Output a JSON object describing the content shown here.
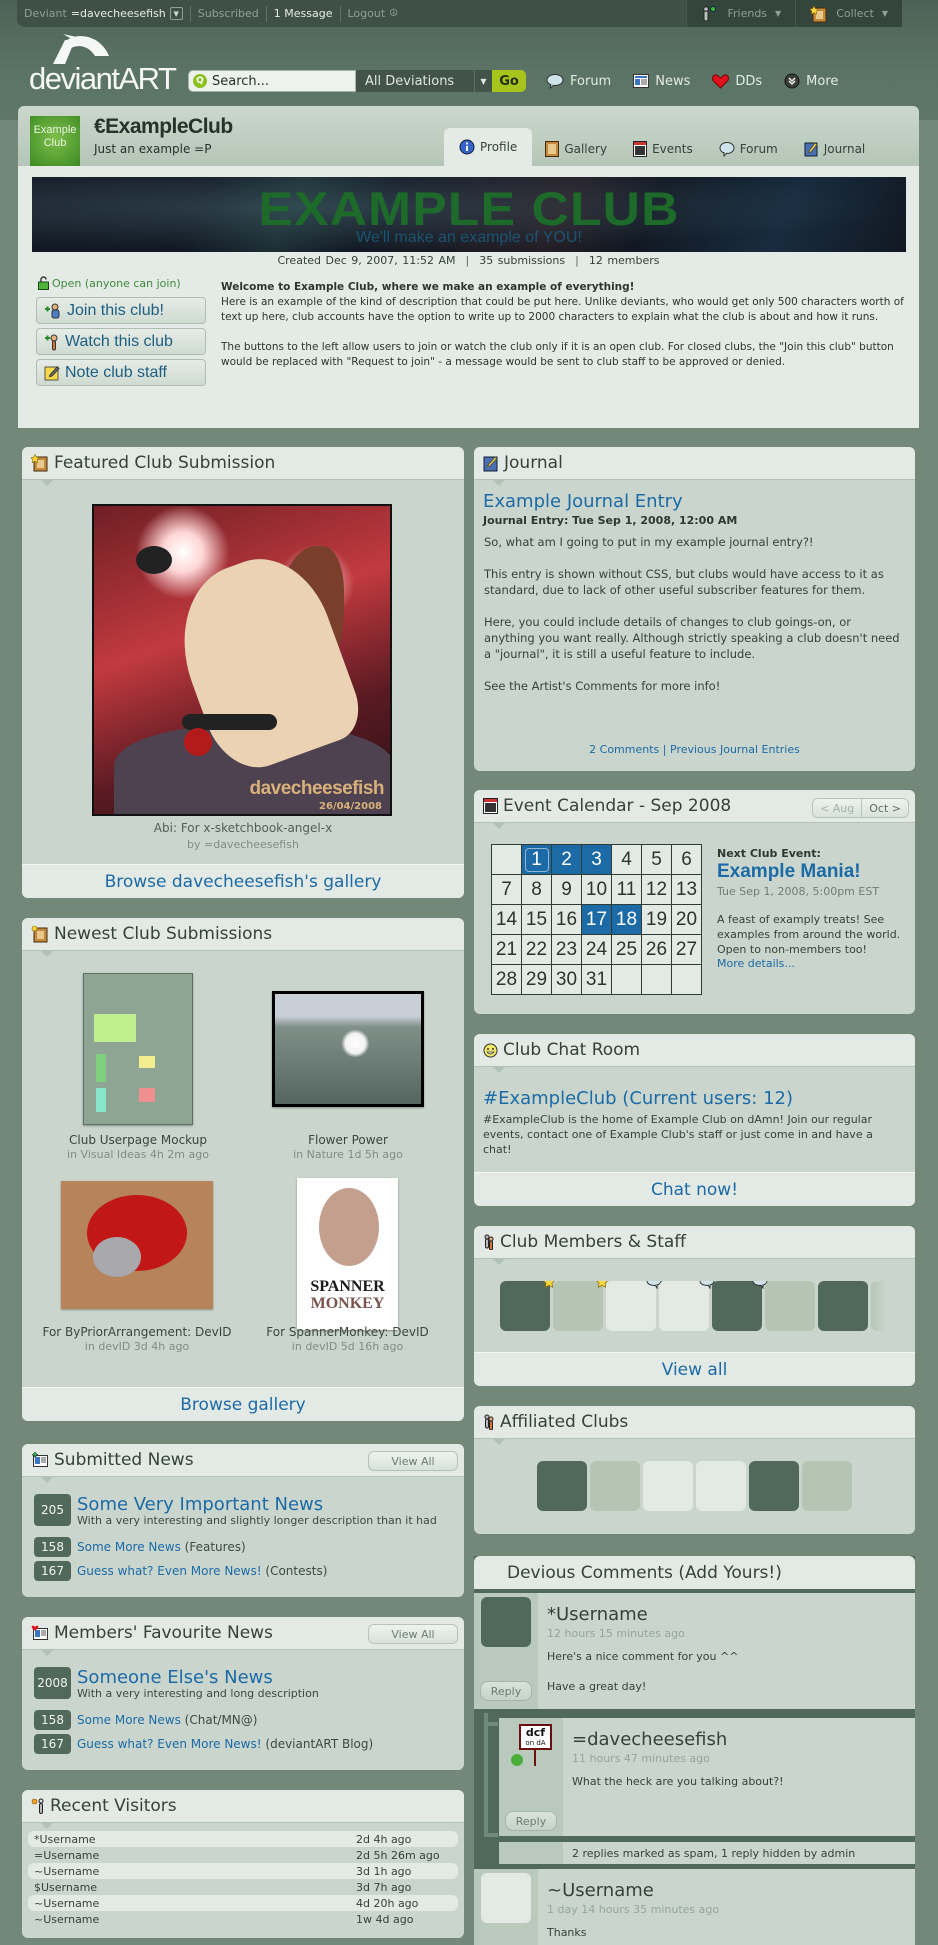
{
  "userbar": {
    "deviant_label": "Deviant",
    "username": "=davecheesefish",
    "subscribed": "Subscribed",
    "messages": "1 Message",
    "logout": "Logout",
    "friends": "Friends",
    "collect": "Collect"
  },
  "logo": {
    "text": "deviantART"
  },
  "search": {
    "placeholder": "Search...",
    "scope": "All Deviations",
    "go": "Go"
  },
  "topnav": [
    {
      "label": "Forum",
      "icon": "speech-bubble-icon"
    },
    {
      "label": "News",
      "icon": "newspaper-icon"
    },
    {
      "label": "DDs",
      "icon": "heart-icon"
    },
    {
      "label": "More",
      "icon": "chevron-down-circle-icon"
    }
  ],
  "club": {
    "icon_text": "Example Club",
    "name": "€ExampleClub",
    "tagline": "Just an example =P",
    "tabs": [
      {
        "label": "Profile",
        "icon": "info-icon",
        "active": true
      },
      {
        "label": "Gallery",
        "icon": "gallery-frame-icon"
      },
      {
        "label": "Events",
        "icon": "calendar-icon"
      },
      {
        "label": "Forum",
        "icon": "speech-bubble-icon"
      },
      {
        "label": "Journal",
        "icon": "journal-book-icon"
      }
    ],
    "banner_title": "EXAMPLE CLUB",
    "banner_subtitle": "We'll make an example of YOU!",
    "created": "Created Dec 9, 2007, 11:52 AM",
    "submissions": "35 submissions",
    "members": "12 members",
    "open_status": "Open (anyone can join)",
    "buttons": {
      "join": "Join this club!",
      "watch": "Watch this club",
      "note": "Note club staff"
    },
    "description_heading": "Welcome to Example Club, where we make an example of everything!",
    "description_p1": "Here is an example of the kind of description that could be put here.  Unlike deviants, who would get only 500 characters worth of text up here, club accounts have the option to write up to 2000 characters to explain what the club is about and how it runs.",
    "description_p2": "The buttons to the left allow users to join or watch the club only if it is an open club.  For closed clubs, the \"Join this club\" button would be replaced with \"Request to join\" - a message would be sent to club staff to be approved or denied."
  },
  "featured": {
    "title": "Featured Club Submission",
    "signature": "davecheesefish",
    "signature_date": "26/04/2008",
    "caption": "Abi: For x-sketchbook-angel-x",
    "by": "by =davecheesefish",
    "footer": "Browse davecheesefish's gallery"
  },
  "newest": {
    "title": "Newest Club Submissions",
    "items": [
      {
        "title": "Club Userpage Mockup",
        "meta": "in Visual Ideas 4h 2m ago"
      },
      {
        "title": "Flower Power",
        "meta": "in Nature 1d 5h ago"
      },
      {
        "title": "For ByPriorArrangement: DevID",
        "meta": "in devID 3d 4h ago"
      },
      {
        "title": "For SpannerMonkey: DevID",
        "meta": "in devID 5d 16h ago"
      }
    ],
    "spanner_text1": "SPANNER",
    "spanner_text2": "MONKEY",
    "footer": "Browse gallery"
  },
  "submitted_news": {
    "title": "Submitted News",
    "view_all": "View All",
    "top": {
      "count": "205",
      "title": "Some Very Important News",
      "desc": "With a very interesting and slightly longer description than it had"
    },
    "items": [
      {
        "count": "158",
        "title": "Some More News",
        "cat": "(Features)"
      },
      {
        "count": "167",
        "title": "Guess what? Even More News!",
        "cat": "(Contests)"
      }
    ]
  },
  "fav_news": {
    "title": "Members' Favourite News",
    "view_all": "View All",
    "top": {
      "count": "2008",
      "title": "Someone Else's News",
      "desc": "With a very interesting and long description"
    },
    "items": [
      {
        "count": "158",
        "title": "Some More News",
        "cat": "(Chat/MN@)"
      },
      {
        "count": "167",
        "title": "Guess what? Even More News!",
        "cat": "(deviantART Blog)"
      }
    ]
  },
  "visitors": {
    "title": "Recent Visitors",
    "rows": [
      {
        "name": "*Username",
        "time": "2d 4h ago"
      },
      {
        "name": "=Username",
        "time": "2d 5h 26m ago"
      },
      {
        "name": "~Username",
        "time": "3d 1h ago"
      },
      {
        "name": "$Username",
        "time": "3d 7h ago"
      },
      {
        "name": "~Username",
        "time": "4d 20h ago"
      },
      {
        "name": "~Username",
        "time": "1w 4d ago"
      }
    ]
  },
  "journal": {
    "title": "Journal",
    "entry_title": "Example Journal Entry",
    "entry_date": "Journal Entry: Tue Sep 1, 2008, 12:00 AM",
    "p1": "So, what am I going to put in my example journal entry?!",
    "p2": "This entry is shown without CSS, but clubs would have access to it as standard, due to lack of other useful subscriber features for them.",
    "p3": "Here, you could include details of changes to club goings-on, or anything you want really.  Although strictly speaking a club doesn't need a \"journal\", it is still a useful feature to include.",
    "p4": "See the Artist's Comments for more info!",
    "comments_link": "2 Comments",
    "separator": "|",
    "previous_link": "Previous Journal Entries"
  },
  "calendar": {
    "title": "Event Calendar - Sep 2008",
    "prev": "< Aug",
    "next": "Oct >",
    "weeks": [
      [
        "",
        "1",
        "2",
        "3",
        "4",
        "5",
        "6"
      ],
      [
        "7",
        "8",
        "9",
        "10",
        "11",
        "12",
        "13"
      ],
      [
        "14",
        "15",
        "16",
        "17",
        "18",
        "19",
        "20"
      ],
      [
        "21",
        "22",
        "23",
        "24",
        "25",
        "26",
        "27"
      ],
      [
        "28",
        "29",
        "30",
        "31",
        "",
        "",
        ""
      ]
    ],
    "event_days": [
      "1",
      "2",
      "3",
      "17",
      "18"
    ],
    "today": "1",
    "next_label": "Next Club Event:",
    "next_name": "Example Mania!",
    "next_date": "Tue Sep 1, 2008, 5:00pm EST",
    "next_desc": "A feast of examply treats! See examples from around the world. Open to non-members too!",
    "more_details": "More details..."
  },
  "chat": {
    "title": "Club Chat Room",
    "room": "#ExampleClub (Current users: 12)",
    "desc": "#ExampleClub is the home of Example Club on dAmn!  Join our regular events, contact one of Example Club's staff or just come in and have a chat!",
    "footer": "Chat now!"
  },
  "members": {
    "title": "Club Members & Staff",
    "tiles": [
      {
        "shade": "dark",
        "badge": "star"
      },
      {
        "shade": "mid",
        "badge": "star"
      },
      {
        "shade": "light",
        "badge": "bubble"
      },
      {
        "shade": "light",
        "badge": "bubble"
      },
      {
        "shade": "dark",
        "badge": "bubble"
      },
      {
        "shade": "mid",
        "badge": ""
      },
      {
        "shade": "dark",
        "badge": ""
      }
    ],
    "footer": "View all"
  },
  "affiliates": {
    "title": "Affiliated Clubs",
    "tiles": [
      "dark",
      "mid",
      "light",
      "light",
      "dark",
      "mid"
    ]
  },
  "comments": {
    "title": "Devious Comments (Add Yours!)",
    "items": [
      {
        "user": "*Username",
        "time": "12 hours 15 minutes ago",
        "text1": "Here's a nice comment for you ^^",
        "text2": "Have a great day!",
        "reply": "Reply"
      },
      {
        "user": "=davecheesefish",
        "time": "11 hours 47 minutes ago",
        "text1": "What the heck are you talking about?!",
        "reply": "Reply",
        "avatar_text1": "dcf",
        "avatar_text2": "on dA"
      },
      {
        "user": "~Username",
        "time": "1 day 14 hours 35 minutes ago",
        "text1": "Thanks"
      }
    ],
    "hidden_note": "2 replies marked as spam, 1 reply hidden by admin"
  }
}
